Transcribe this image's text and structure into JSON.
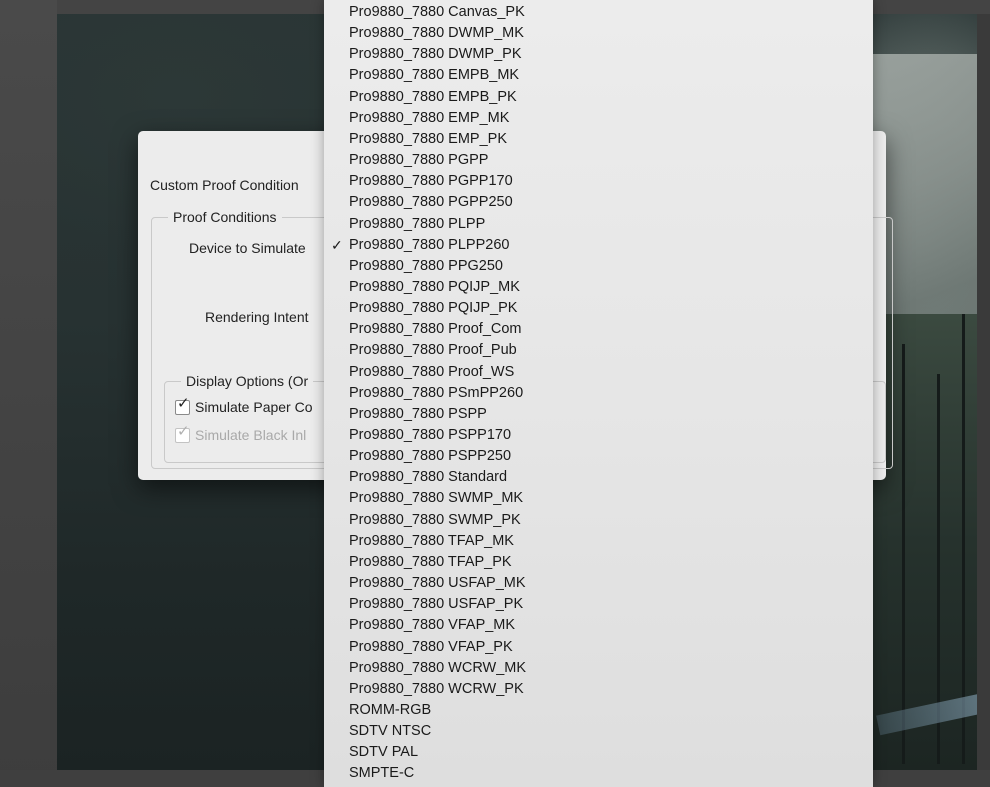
{
  "dialog": {
    "custom_proof_condition_label": "Custom Proof Condition",
    "proof_conditions_title": "Proof Conditions",
    "device_to_simulate_label": "Device to Simulate",
    "rendering_intent_label": "Rendering Intent",
    "display_options_title": "Display Options (Or",
    "simulate_paper_label": "Simulate Paper Co",
    "simulate_black_label": "Simulate Black Inl"
  },
  "menu": {
    "selected_index": 11,
    "check_glyph": "✓",
    "items": [
      "Pro9880_7880 Canvas_PK",
      "Pro9880_7880 DWMP_MK",
      "Pro9880_7880 DWMP_PK",
      "Pro9880_7880 EMPB_MK",
      "Pro9880_7880 EMPB_PK",
      "Pro9880_7880 EMP_MK",
      "Pro9880_7880 EMP_PK",
      "Pro9880_7880 PGPP",
      "Pro9880_7880 PGPP170",
      "Pro9880_7880 PGPP250",
      "Pro9880_7880 PLPP",
      "Pro9880_7880 PLPP260",
      "Pro9880_7880 PPG250",
      "Pro9880_7880 PQIJP_MK",
      "Pro9880_7880 PQIJP_PK",
      "Pro9880_7880 Proof_Com",
      "Pro9880_7880 Proof_Pub",
      "Pro9880_7880 Proof_WS",
      "Pro9880_7880 PSmPP260",
      "Pro9880_7880 PSPP",
      "Pro9880_7880 PSPP170",
      "Pro9880_7880 PSPP250",
      "Pro9880_7880 Standard",
      "Pro9880_7880 SWMP_MK",
      "Pro9880_7880 SWMP_PK",
      "Pro9880_7880 TFAP_MK",
      "Pro9880_7880 TFAP_PK",
      "Pro9880_7880 USFAP_MK",
      "Pro9880_7880 USFAP_PK",
      "Pro9880_7880 VFAP_MK",
      "Pro9880_7880 VFAP_PK",
      "Pro9880_7880 WCRW_MK",
      "Pro9880_7880 WCRW_PK",
      "ROMM-RGB",
      "SDTV NTSC",
      "SDTV PAL",
      "SMPTE-C"
    ]
  }
}
